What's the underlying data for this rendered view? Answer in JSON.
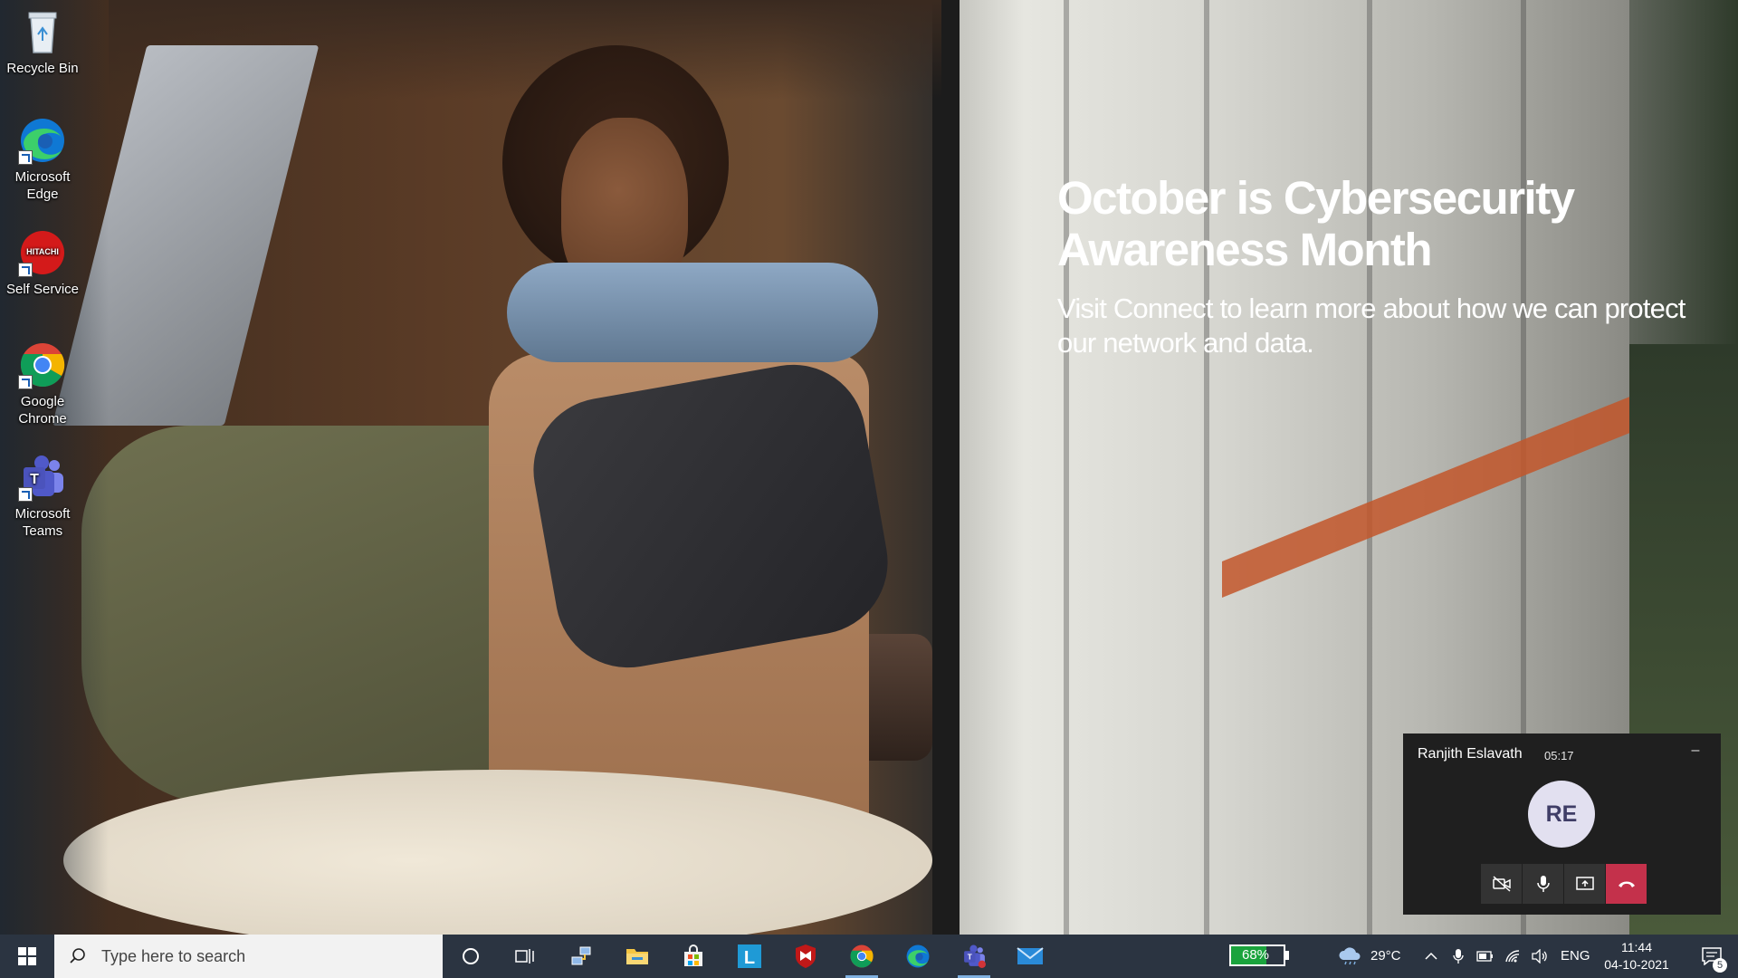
{
  "wallpaper": {
    "headline": "October is Cybersecurity Awareness Month",
    "subtext": "Visit Connect to learn more about how we can protect our network and data."
  },
  "desktop_icons": [
    {
      "label": "Recycle Bin",
      "icon": "recycle-bin-icon"
    },
    {
      "label": "Microsoft Edge",
      "icon": "edge-icon"
    },
    {
      "label": "Self Service",
      "icon": "hitachi-self-service-icon"
    },
    {
      "label": "Google Chrome",
      "icon": "chrome-icon"
    },
    {
      "label": "Microsoft Teams",
      "icon": "teams-icon"
    }
  ],
  "call": {
    "name": "Ranjith Eslavath",
    "duration": "05:17",
    "initials": "RE",
    "controls": [
      "camera-off-icon",
      "microphone-icon",
      "share-screen-icon",
      "hang-up-icon"
    ]
  },
  "taskbar": {
    "search_placeholder": "Type here to search",
    "pinned": [
      "cortana-icon",
      "task-view-icon",
      "network-app-icon",
      "file-explorer-icon",
      "microsoft-store-icon",
      "lenovo-icon",
      "mcafee-icon",
      "chrome-icon",
      "edge-icon",
      "teams-icon",
      "mail-icon"
    ],
    "battery_text": "68%",
    "battery_level": 0.68,
    "weather": "29°C",
    "language": "ENG",
    "time": "11:44",
    "date": "04-10-2021",
    "notification_count": "5"
  },
  "colors": {
    "taskbar_bg": "#2b3441",
    "hang_up": "#c4314b",
    "battery_green": "#1aa33d"
  }
}
